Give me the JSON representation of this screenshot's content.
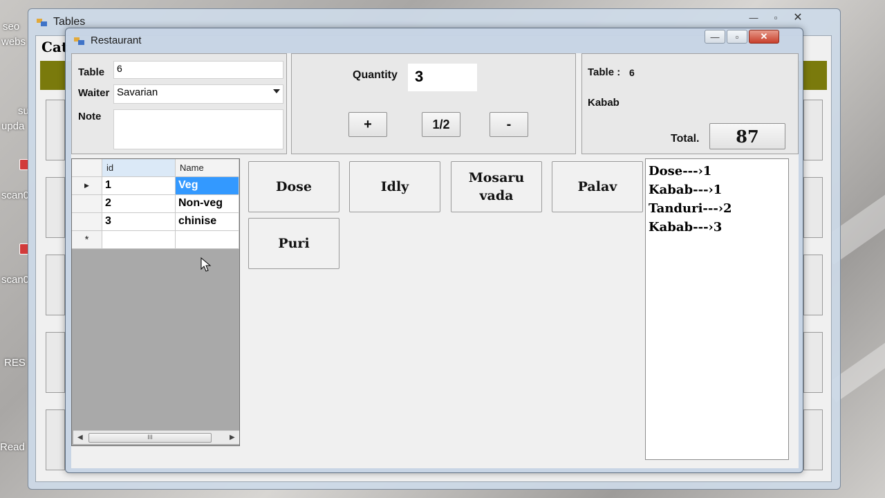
{
  "tables_window": {
    "title": "Tables",
    "category_label": "Cat"
  },
  "restaurant_window": {
    "title": "Restaurant",
    "caption": {
      "minimize": "—",
      "maximize": "▫",
      "close": "✕"
    }
  },
  "order_form": {
    "table_label": "Table",
    "table_value": "6",
    "waiter_label": "Waiter",
    "waiter_value": "Savarian",
    "note_label": "Note",
    "note_value": ""
  },
  "quantity": {
    "label": "Quantity",
    "value": "3",
    "plus_label": "+",
    "half_label": "1/2",
    "minus_label": "-"
  },
  "summary": {
    "table_label": "Table :",
    "table_value": "6",
    "item": "Kabab",
    "total_label": "Total.",
    "total_value": "87"
  },
  "category_grid": {
    "columns": [
      "id",
      "Name"
    ],
    "rows": [
      {
        "id": "1",
        "name": "Veg",
        "selected": true
      },
      {
        "id": "2",
        "name": "Non-veg"
      },
      {
        "id": "3",
        "name": "chinise"
      }
    ],
    "current_row_marker": "▶",
    "new_row_marker": "*",
    "scroll_thumb": "III"
  },
  "menu_items": [
    {
      "label": "Dose"
    },
    {
      "label": "Idly"
    },
    {
      "label": "Mosaru vada"
    },
    {
      "label": "Palav"
    },
    {
      "label": "Puri"
    }
  ],
  "order_list": [
    "Dose---›1",
    "Kabab---›1",
    "Tanduri---›2",
    "Kabab---›3"
  ],
  "desktop_labels": [
    "seo",
    "webs",
    "su",
    "upda",
    "scan0",
    "scan0",
    "RES",
    "Read"
  ],
  "colors": {
    "selection": "#3399ff",
    "category_bar": "#7a7a0c",
    "grid_background": "#a9a9a9"
  }
}
